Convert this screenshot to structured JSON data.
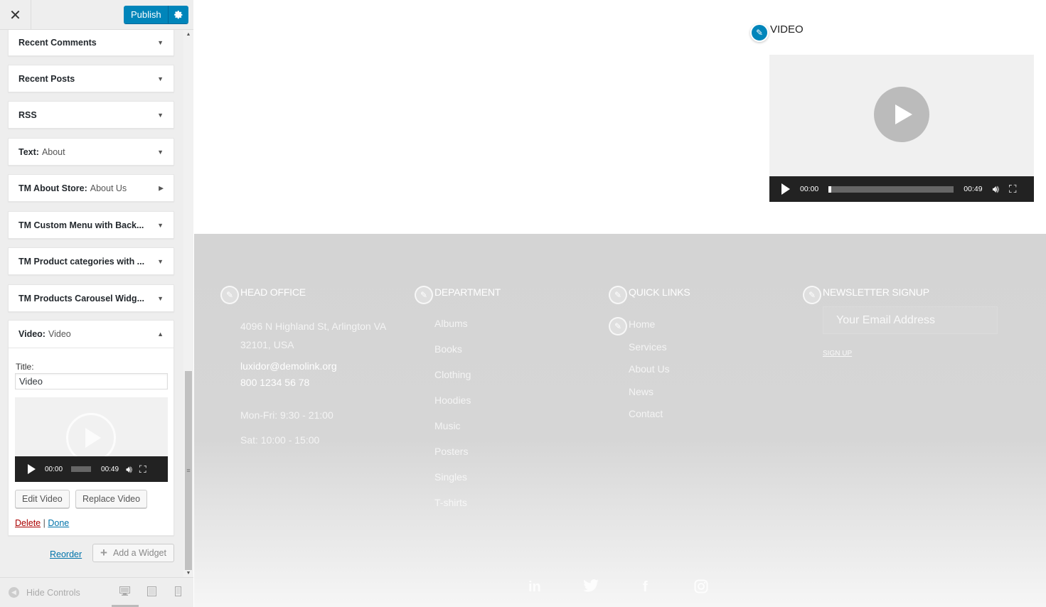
{
  "topbar": {
    "close_glyph": "✕",
    "publish_label": "Publish",
    "settings_icon": "gear-icon"
  },
  "widgets": [
    {
      "name": "Recent Comments",
      "sub": ""
    },
    {
      "name": "Recent Posts",
      "sub": ""
    },
    {
      "name": "RSS",
      "sub": ""
    },
    {
      "name": "Text:",
      "sub": "About"
    },
    {
      "name": "TM About Store:",
      "sub": "About Us"
    },
    {
      "name": "TM Custom Menu with Back...",
      "sub": ""
    },
    {
      "name": "TM Product categories with ...",
      "sub": ""
    },
    {
      "name": "TM Products Carousel Widg...",
      "sub": ""
    }
  ],
  "video_widget": {
    "name": "Video:",
    "sub": "Video",
    "title_label": "Title:",
    "title_value": "Video",
    "player": {
      "current_time": "00:00",
      "duration": "00:49"
    },
    "edit_label": "Edit Video",
    "replace_label": "Replace Video",
    "delete_label": "Delete",
    "separator": "|",
    "done_label": "Done"
  },
  "panel_footer": {
    "reorder_label": "Reorder",
    "add_widget_label": "Add a Widget"
  },
  "controls": {
    "hide_label": "Hide Controls"
  },
  "preview": {
    "video_title": "VIDEO",
    "player": {
      "current_time": "00:00",
      "duration": "00:49"
    },
    "footer": {
      "head_office": {
        "title": "HEAD OFFICE",
        "address1": "4096 N Highland St, Arlington VA",
        "address2": "32101, USA",
        "email": "luxidor@demolink.org",
        "phone": "800 1234 56 78",
        "hours1": "Mon-Fri: 9:30 - 21:00",
        "hours2": "Sat: 10:00 - 15:00"
      },
      "department": {
        "title": "DEPARTMENT",
        "links": [
          "Albums",
          "Books",
          "Clothing",
          "Hoodies",
          "Music",
          "Posters",
          "Singles",
          "T-shirts"
        ]
      },
      "quick_links": {
        "title": "QUICK LINKS",
        "links": [
          "Home",
          "Services",
          "About Us",
          "News",
          "Contact"
        ]
      },
      "newsletter": {
        "title": "NEWSLETTER SIGNUP",
        "placeholder": "Your Email Address",
        "signup_label": "SIGN UP"
      },
      "social_icons": [
        "linkedin-icon",
        "twitter-icon",
        "facebook-icon",
        "instagram-icon"
      ]
    }
  },
  "colors": {
    "accent": "#0085ba",
    "delete": "#a00000",
    "link": "#0073aa"
  }
}
